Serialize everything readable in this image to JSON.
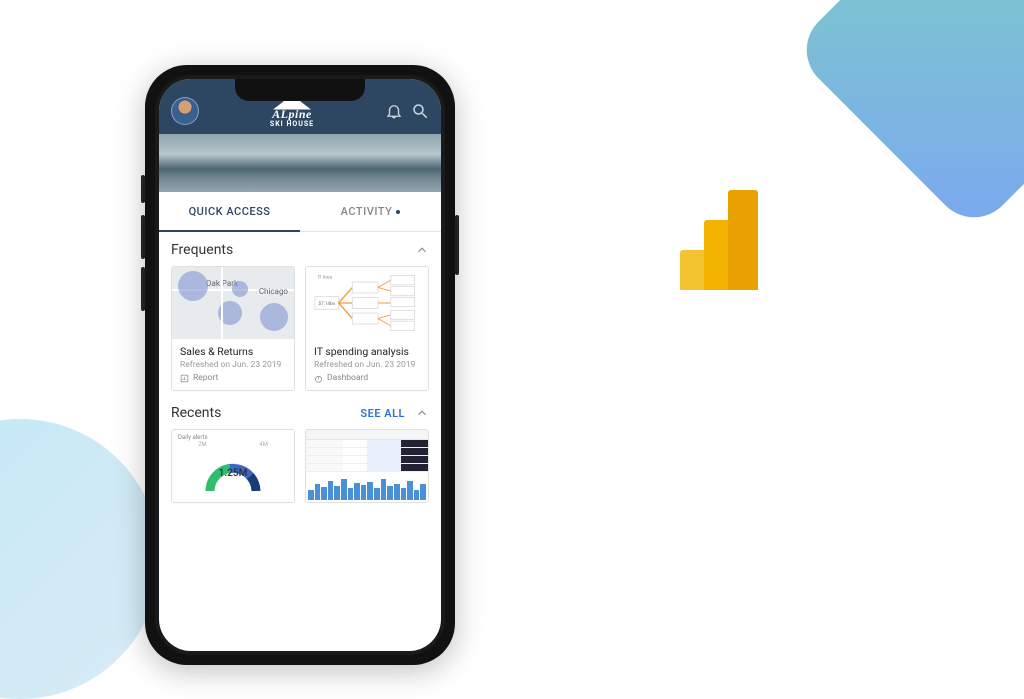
{
  "brand": {
    "title": "ALpine",
    "sub": "SKI HOUSE"
  },
  "tabs": {
    "quick_access": "QUICK ACCESS",
    "activity": "ACTIVITY"
  },
  "sections": {
    "frequents": {
      "title": "Frequents",
      "cards": [
        {
          "title": "Sales & Returns",
          "refreshed": "Refreshed on Jun. 23 2019",
          "type": "Report",
          "preview_label": "Chicago"
        },
        {
          "title": "IT spending analysis",
          "refreshed": "Refreshed on Jun. 23 2019",
          "type": "Dashboard"
        }
      ]
    },
    "recents": {
      "title": "Recents",
      "see_all": "SEE ALL",
      "cards": [
        {
          "donut_label": "Daily alerts",
          "donut_center": "1.25M",
          "donut_axis_left": "2M",
          "donut_axis_right": "4M"
        },
        {}
      ]
    }
  },
  "colors": {
    "header_bg": "#2d4763",
    "accent": "#2d70cc",
    "pbi_yellow_light": "#f4c430",
    "pbi_yellow_mid": "#f2b200",
    "pbi_yellow_dark": "#e8a100"
  }
}
